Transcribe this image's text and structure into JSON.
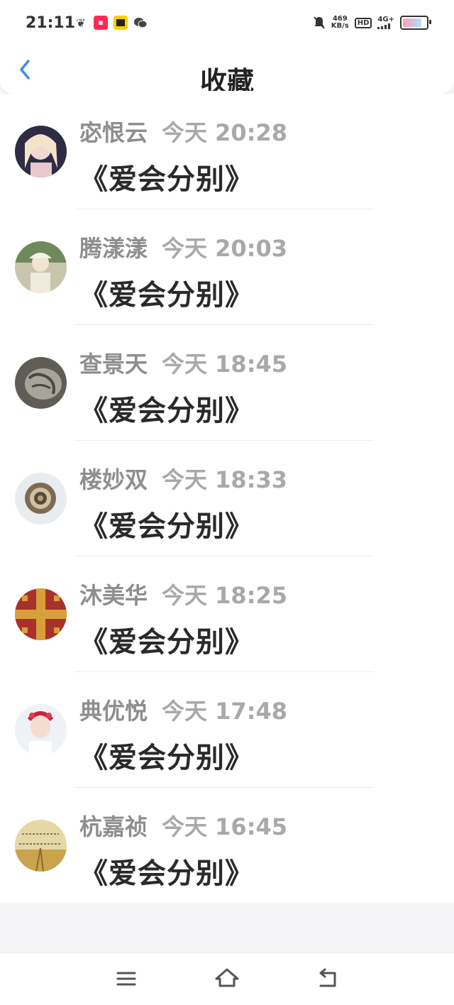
{
  "status": {
    "time": "21:11",
    "net_speed_value": "469",
    "net_speed_unit": "KB/s",
    "hd_label": "HD",
    "network_label": "4G+"
  },
  "header": {
    "title": "收藏"
  },
  "items": [
    {
      "author": "宓恨云",
      "time": "今天 20:28",
      "title": "《爱会分别》",
      "avatar_color": "#3a3a52"
    },
    {
      "author": "腾漾漾",
      "time": "今天 20:03",
      "title": "《爱会分别》",
      "avatar_color": "#b5b19a"
    },
    {
      "author": "查景天",
      "time": "今天 18:45",
      "title": "《爱会分别》",
      "avatar_color": "#7a7a72"
    },
    {
      "author": "楼妙双",
      "time": "今天 18:33",
      "title": "《爱会分别》",
      "avatar_color": "#a48a6a"
    },
    {
      "author": "沐美华",
      "time": "今天 18:25",
      "title": "《爱会分别》",
      "avatar_color": "#c08a2a"
    },
    {
      "author": "典优悦",
      "time": "今天 17:48",
      "title": "《爱会分别》",
      "avatar_color": "#e9eef5"
    },
    {
      "author": "杭嘉祯",
      "time": "今天 16:45",
      "title": "《爱会分别》",
      "avatar_color": "#d9c27a"
    }
  ],
  "colors": {
    "accent": "#3a8ee6",
    "author_text": "#8e8e8e",
    "time_text": "#a9a9a9",
    "title_text": "#2a2a2a"
  },
  "icons": {
    "back": "chevron-left-icon",
    "menu": "menu-icon",
    "home": "home-icon",
    "return": "return-icon"
  }
}
